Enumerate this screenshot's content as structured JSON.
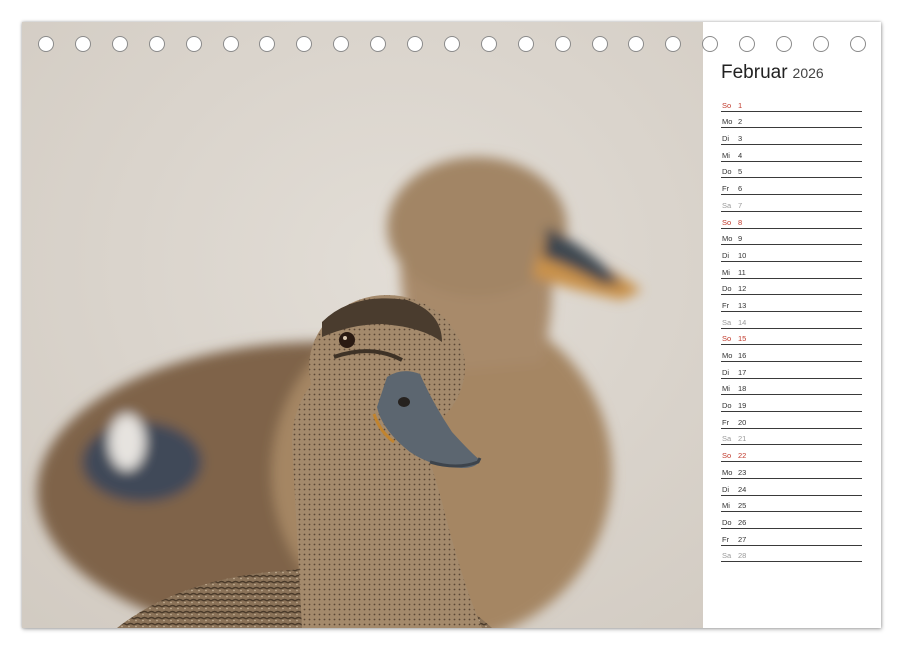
{
  "calendar": {
    "month": "Februar",
    "year": "2026",
    "colors": {
      "sunday": "#c0392b",
      "saturday": "#9a9a9a",
      "weekday": "#333333"
    },
    "days": [
      {
        "wd": "So",
        "d": "1",
        "type": "sun"
      },
      {
        "wd": "Mo",
        "d": "2",
        "type": "day"
      },
      {
        "wd": "Di",
        "d": "3",
        "type": "day"
      },
      {
        "wd": "Mi",
        "d": "4",
        "type": "day"
      },
      {
        "wd": "Do",
        "d": "5",
        "type": "day"
      },
      {
        "wd": "Fr",
        "d": "6",
        "type": "day"
      },
      {
        "wd": "Sa",
        "d": "7",
        "type": "sat"
      },
      {
        "wd": "So",
        "d": "8",
        "type": "sun"
      },
      {
        "wd": "Mo",
        "d": "9",
        "type": "day"
      },
      {
        "wd": "Di",
        "d": "10",
        "type": "day"
      },
      {
        "wd": "Mi",
        "d": "11",
        "type": "day"
      },
      {
        "wd": "Do",
        "d": "12",
        "type": "day"
      },
      {
        "wd": "Fr",
        "d": "13",
        "type": "day"
      },
      {
        "wd": "Sa",
        "d": "14",
        "type": "sat"
      },
      {
        "wd": "So",
        "d": "15",
        "type": "sun"
      },
      {
        "wd": "Mo",
        "d": "16",
        "type": "day"
      },
      {
        "wd": "Di",
        "d": "17",
        "type": "day"
      },
      {
        "wd": "Mi",
        "d": "18",
        "type": "day"
      },
      {
        "wd": "Do",
        "d": "19",
        "type": "day"
      },
      {
        "wd": "Fr",
        "d": "20",
        "type": "day"
      },
      {
        "wd": "Sa",
        "d": "21",
        "type": "sat"
      },
      {
        "wd": "So",
        "d": "22",
        "type": "sun"
      },
      {
        "wd": "Mo",
        "d": "23",
        "type": "day"
      },
      {
        "wd": "Di",
        "d": "24",
        "type": "day"
      },
      {
        "wd": "Mi",
        "d": "25",
        "type": "day"
      },
      {
        "wd": "Do",
        "d": "26",
        "type": "day"
      },
      {
        "wd": "Fr",
        "d": "27",
        "type": "day"
      },
      {
        "wd": "Sa",
        "d": "28",
        "type": "sat"
      }
    ]
  },
  "photo": {
    "icon": "mallard-ducks-photo",
    "colors": {
      "background": "#dcd6ce",
      "duck_body": "#9a7a58",
      "beak": "#5c6670"
    }
  }
}
